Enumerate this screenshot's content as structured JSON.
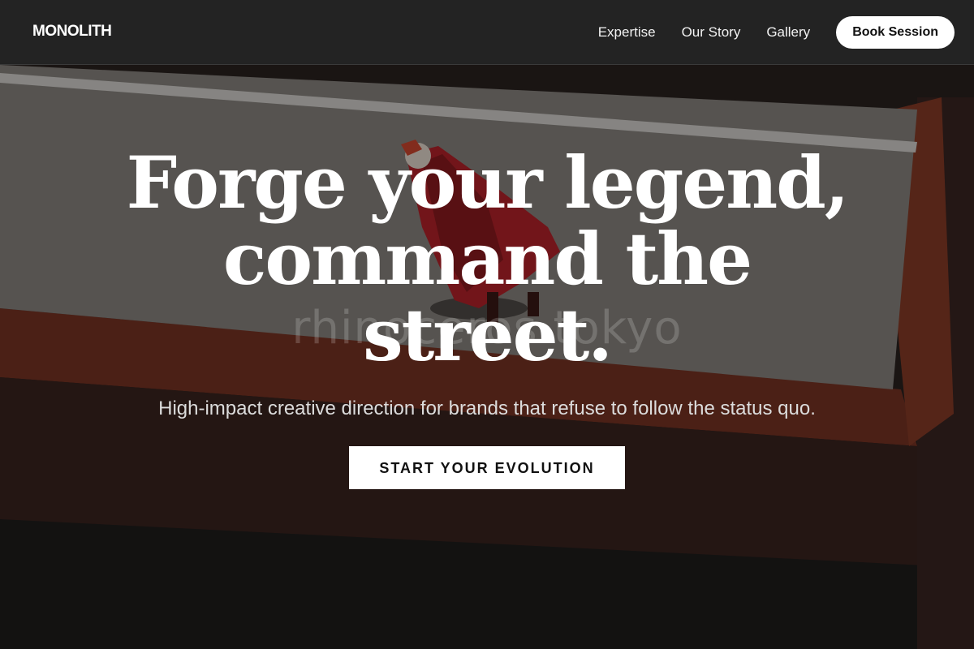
{
  "header": {
    "logo": "MONOLITH",
    "nav": [
      {
        "label": "Expertise"
      },
      {
        "label": "Our Story"
      },
      {
        "label": "Gallery"
      }
    ],
    "book_label": "Book Session"
  },
  "hero": {
    "title_line1": "Forge your legend,",
    "title_line2": "command the",
    "title_line3": "street.",
    "subtitle": "High-impact creative direction for brands that refuse to follow the status quo.",
    "cta_label": "START YOUR EVOLUTION",
    "watermark": "rhinoceros tokyo"
  },
  "colors": {
    "header_bg": "#232323",
    "button_bg": "#ffffff",
    "accent_red": "#c0392b"
  }
}
